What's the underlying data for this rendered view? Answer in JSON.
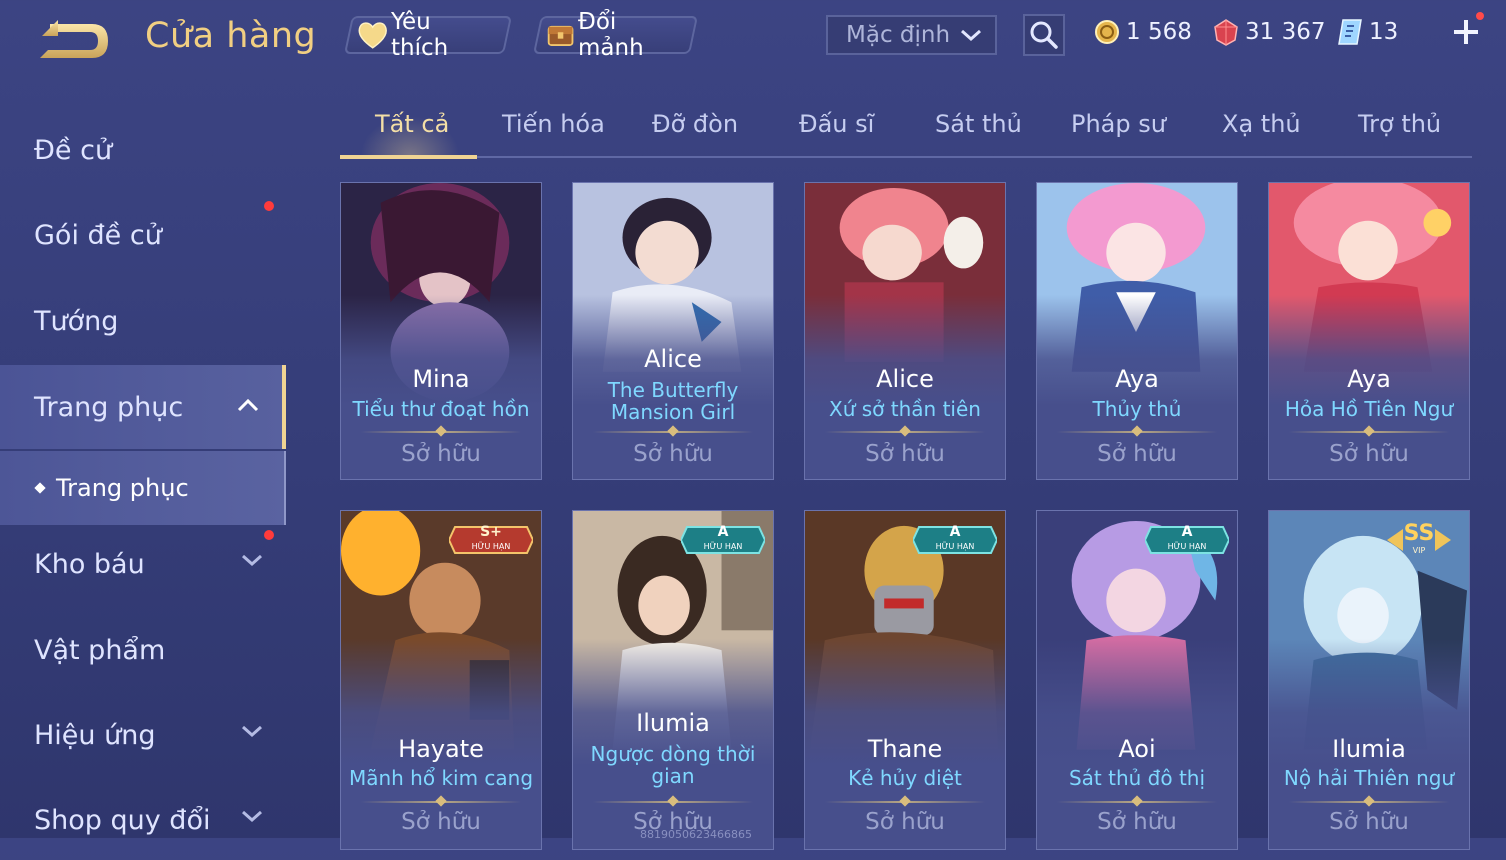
{
  "header": {
    "title": "Cửa hàng",
    "favorite_label": "Yêu thích",
    "exchange_label": "Đổi mảnh",
    "sort_value": "Mặc định",
    "currencies": {
      "gold": "1 568",
      "gems": "31 367",
      "vouchers": "13"
    }
  },
  "sidebar": {
    "items": [
      {
        "label": "Đề cử"
      },
      {
        "label": "Gói đề cử"
      },
      {
        "label": "Tướng"
      },
      {
        "label": "Trang phục"
      },
      {
        "label": "Kho báu"
      },
      {
        "label": "Vật phẩm"
      },
      {
        "label": "Hiệu ứng"
      },
      {
        "label": "Shop quy đổi"
      }
    ],
    "sub_item": "Trang phục"
  },
  "tabs": [
    "Tất cả",
    "Tiến hóa",
    "Đỡ đòn",
    "Đấu sĩ",
    "Sát thủ",
    "Pháp sư",
    "Xạ thủ",
    "Trợ thủ"
  ],
  "cards_row1": [
    {
      "hero": "Mina",
      "skin": "Tiểu thư đoạt hồn",
      "status": "Sở hữu"
    },
    {
      "hero": "Alice",
      "skin": "The Butterfly Mansion Girl",
      "status": "Sở hữu"
    },
    {
      "hero": "Alice",
      "skin": "Xứ sở thần tiên",
      "status": "Sở hữu"
    },
    {
      "hero": "Aya",
      "skin": "Thủy thủ",
      "status": "Sở hữu"
    },
    {
      "hero": "Aya",
      "skin": "Hỏa Hồ Tiên Ngư",
      "status": "Sở hữu"
    }
  ],
  "cards_row2": [
    {
      "hero": "Hayate",
      "skin": "Mãnh hổ kim cang",
      "status": "Sở hữu",
      "badge": "S+",
      "badge_sub": "HỮU HẠN"
    },
    {
      "hero": "Ilumia",
      "skin": "Ngược dòng thời gian",
      "status": "Sở hữu",
      "badge": "A",
      "badge_sub": "HỮU HẠN"
    },
    {
      "hero": "Thane",
      "skin": "Kẻ hủy diệt",
      "status": "Sở hữu",
      "badge": "A",
      "badge_sub": "HỮU HẠN"
    },
    {
      "hero": "Aoi",
      "skin": "Sát thủ đô thị",
      "status": "Sở hữu",
      "badge": "A",
      "badge_sub": "HỮU HẠN"
    },
    {
      "hero": "Ilumia",
      "skin": "Nộ hải Thiên ngư",
      "status": "Sở hữu",
      "badge": "SS",
      "badge_sub": "VIP"
    }
  ],
  "watermark": "8819050623466865",
  "colors": {
    "accent_gold": "#f0d493",
    "skin_name": "#7fd8ff",
    "background": "#3c4483"
  }
}
